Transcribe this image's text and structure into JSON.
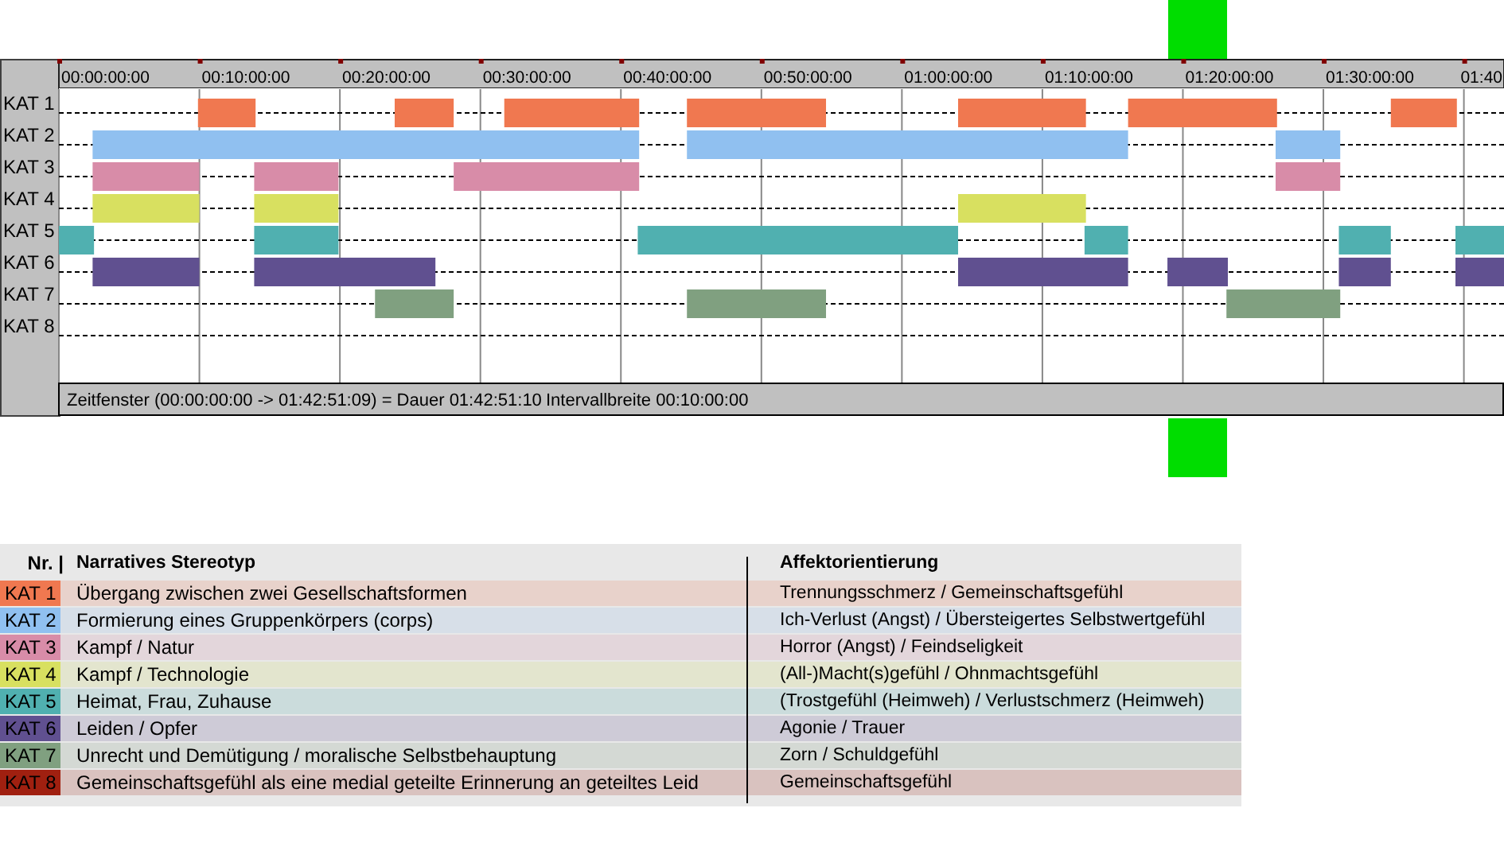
{
  "timeline": {
    "ticks": [
      "00:00:00:00",
      "00:10:00:00",
      "00:20:00:00",
      "00:30:00:00",
      "00:40:00:00",
      "00:50:00:00",
      "01:00:00:00",
      "01:10:00:00",
      "01:20:00:00",
      "01:30:00:00",
      "01:40"
    ],
    "rows": [
      {
        "label": "KAT 1"
      },
      {
        "label": "KAT 2"
      },
      {
        "label": "KAT 3"
      },
      {
        "label": "KAT 4"
      },
      {
        "label": "KAT 5"
      },
      {
        "label": "KAT 6"
      },
      {
        "label": "KAT 7"
      },
      {
        "label": "KAT 8"
      }
    ],
    "status_bar": {
      "window": "Zeitfenster (00:00:00:00 -> 01:42:51:09) = Dauer 01:42:51:10",
      "interval": "Intervallbreite 00:10:00:00"
    }
  },
  "legend": {
    "columns": [
      "Nr. |",
      "Narratives Stereotyp",
      "Affektorientierung"
    ],
    "rows": [
      {
        "label": "KAT 1",
        "color": "#f07850",
        "stereotype": "Übergang zwischen zwei Gesellschaftsformen",
        "affect": "Trennungsschmerz / Gemeinschaftsgefühl"
      },
      {
        "label": "KAT 2",
        "color": "#90c0f0",
        "stereotype": "Formierung eines Gruppenkörpers (corps)",
        "affect": "Ich-Verlust (Angst) / Übersteigertes Selbstwertgefühl"
      },
      {
        "label": "KAT 3",
        "color": "#d88ca8",
        "stereotype": "Kampf / Natur",
        "affect": "Horror (Angst) / Feindseligkeit"
      },
      {
        "label": "KAT 4",
        "color": "#d8e060",
        "stereotype": "Kampf / Technologie",
        "affect": "(All-)Macht(s)gefühl / Ohnmachtsgefühl"
      },
      {
        "label": "KAT 5",
        "color": "#50b0b0",
        "stereotype": "Heimat, Frau, Zuhause",
        "affect": "(Trostgefühl (Heimweh) / Verlustschmerz (Heimweh)"
      },
      {
        "label": "KAT 6",
        "color": "#605090",
        "stereotype": "Leiden / Opfer",
        "affect": "Agonie / Trauer"
      },
      {
        "label": "KAT 7",
        "color": "#80a080",
        "stereotype": "Unrecht und Demütigung / moralische Selbstbehauptung",
        "affect": "Zorn / Schuldgefühl"
      },
      {
        "label": "KAT 8",
        "color": "#a02010",
        "stereotype": "Gemeinschaftsgefühl als eine medial geteilte Erinnerung an geteiltes Leid",
        "affect": "Gemeinschaftsgefühl"
      }
    ]
  }
}
